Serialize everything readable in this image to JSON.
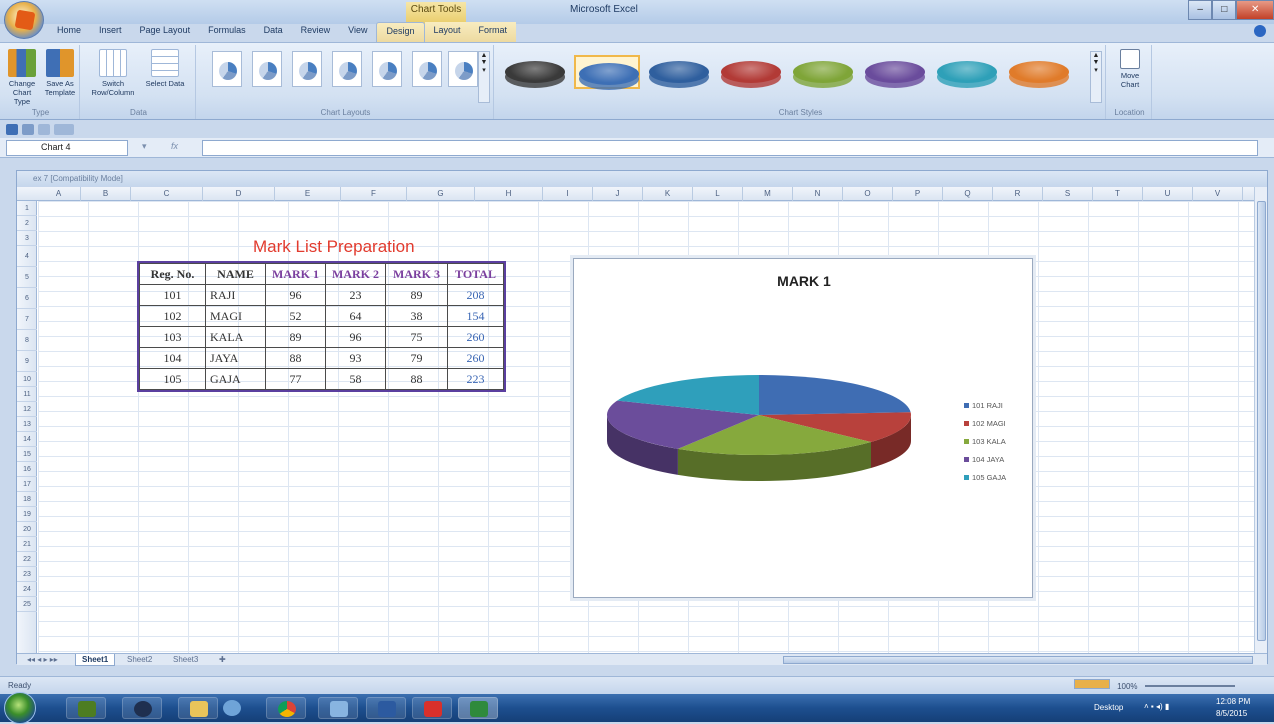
{
  "window": {
    "app_title": "Microsoft Excel",
    "context_tab_group": "Chart Tools",
    "controls": [
      "–",
      "□",
      "✕"
    ]
  },
  "ribbon_tabs": [
    "Home",
    "Insert",
    "Page Layout",
    "Formulas",
    "Data",
    "Review",
    "View",
    "Design",
    "Layout",
    "Format"
  ],
  "active_tab": "Design",
  "ribbon": {
    "type_group": {
      "label": "Type",
      "buttons": [
        "Change Chart Type",
        "Save As Template"
      ]
    },
    "data_group": {
      "label": "Data",
      "buttons": [
        "Switch Row/Column",
        "Select Data"
      ]
    },
    "layouts_group": {
      "label": "Chart Layouts"
    },
    "styles_group": {
      "label": "Chart Styles"
    },
    "location_group": {
      "label": "Location",
      "buttons": [
        "Move Chart"
      ]
    }
  },
  "style_colors": [
    "#3a3a3a",
    "#3d6fb5",
    "#2f5f9e",
    "#b23a36",
    "#7fa538",
    "#6a4c9c",
    "#2ea0b8",
    "#e07b2a"
  ],
  "formula_bar": {
    "name_box": "Chart 4",
    "fx": "fx",
    "formula": ""
  },
  "workbook": {
    "title": "ex 7 [Compatibility Mode]",
    "columns": [
      "A",
      "B",
      "C",
      "D",
      "E",
      "F",
      "G",
      "H",
      "I",
      "J",
      "K",
      "L",
      "M",
      "N",
      "O",
      "P",
      "Q",
      "R",
      "S",
      "T",
      "U",
      "V"
    ],
    "rows": [
      "1",
      "2",
      "3",
      "4",
      "5",
      "6",
      "7",
      "8",
      "9",
      "10",
      "11",
      "12",
      "13",
      "14",
      "15",
      "16",
      "17",
      "18",
      "19",
      "20",
      "21",
      "22",
      "23",
      "24",
      "25"
    ],
    "sheets": [
      "Sheet1",
      "Sheet2",
      "Sheet3"
    ],
    "active_sheet": "Sheet1"
  },
  "sheet": {
    "title": "Mark List Preparation",
    "table": {
      "headers": [
        "Reg. No.",
        "NAME",
        "MARK 1",
        "MARK 2",
        "MARK 3",
        "TOTAL"
      ],
      "rows": [
        [
          "101",
          "RAJI",
          "96",
          "23",
          "89",
          "208"
        ],
        [
          "102",
          "MAGI",
          "52",
          "64",
          "38",
          "154"
        ],
        [
          "103",
          "KALA",
          "89",
          "96",
          "75",
          "260"
        ],
        [
          "104",
          "JAYA",
          "88",
          "93",
          "79",
          "260"
        ],
        [
          "105",
          "GAJA",
          "77",
          "58",
          "88",
          "223"
        ]
      ]
    }
  },
  "chart_data": {
    "type": "pie",
    "title": "MARK 1",
    "categories": [
      "101 RAJI",
      "102 MAGI",
      "103 KALA",
      "104 JAYA",
      "105 GAJA"
    ],
    "values": [
      96,
      52,
      89,
      88,
      77
    ],
    "colors": [
      "#3f6db3",
      "#b8413c",
      "#86a93d",
      "#6b4d9b",
      "#2f9fbb"
    ],
    "legend": "right",
    "style": "3d"
  },
  "status": {
    "text": "Ready",
    "zoom": "100%"
  },
  "taskbar": {
    "apps": [
      "Dreamweaver",
      "Media Player",
      "File Explorer",
      "Paint",
      "Chrome",
      "Network",
      "Word",
      "Acrobat",
      "Excel"
    ],
    "tray_label": "Desktop",
    "time": "12:08 PM",
    "date": "8/5/2015"
  }
}
